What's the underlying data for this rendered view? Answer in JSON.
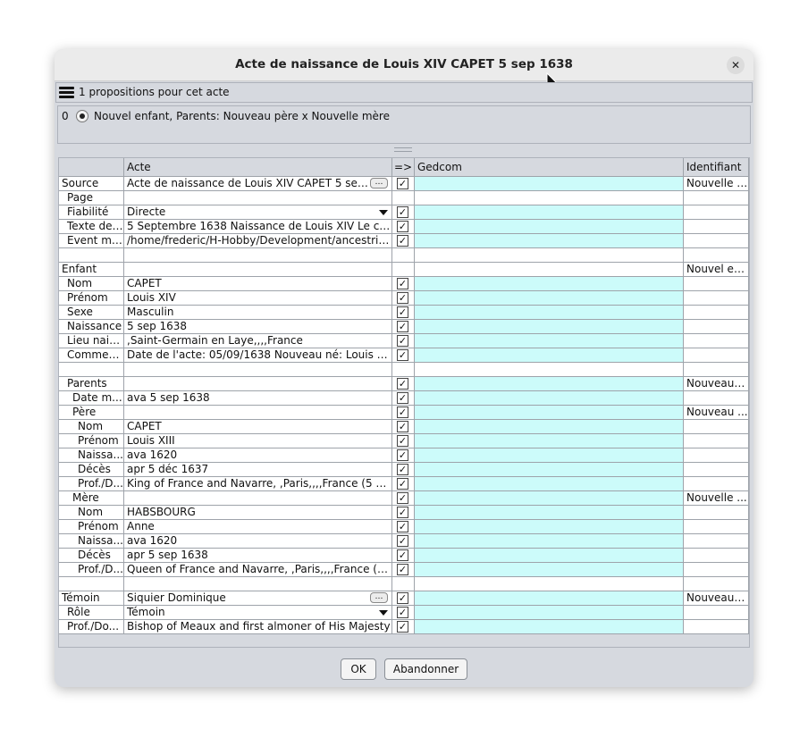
{
  "window": {
    "title": "Acte de naissance de Louis XIV CAPET 5 sep 1638",
    "close_label": "✕"
  },
  "toolbar": {
    "label": "1 propositions pour cet acte"
  },
  "proposal": {
    "index": "0",
    "label": "Nouvel enfant, Parents: Nouveau père x Nouvelle mère"
  },
  "table": {
    "columns": [
      "",
      "Acte",
      "=>",
      "Gedcom",
      "Identifiant"
    ],
    "rows": [
      {
        "label": "Source",
        "value": "Acte de naissance de Louis XIV CAPET 5 sep 16...",
        "check": true,
        "gedcom": true,
        "id": "Nouvelle s...",
        "widget": "dots"
      },
      {
        "label": "Page",
        "indent": 1,
        "value": "",
        "check": false,
        "gedcom": false,
        "id": ""
      },
      {
        "label": "Fiabilité",
        "indent": 1,
        "value": "Directe",
        "check": true,
        "gedcom": true,
        "id": "",
        "widget": "dropdown"
      },
      {
        "label": "Texte de ...",
        "indent": 1,
        "value": "5 Septembre 1638 Naissance de Louis XIV Le cinqu...",
        "check": true,
        "gedcom": true,
        "id": ""
      },
      {
        "label": "Event me...",
        "indent": 1,
        "value": "/home/frederic/H-Hobby/Development/ancestris/tr...",
        "check": true,
        "gedcom": true,
        "id": ""
      },
      {
        "label": "",
        "value": "",
        "check": false,
        "gedcom": false,
        "id": "",
        "blank": true
      },
      {
        "label": "Enfant",
        "value": "",
        "check": false,
        "gedcom": false,
        "id": "Nouvel en..."
      },
      {
        "label": "Nom",
        "indent": 1,
        "value": "CAPET",
        "check": true,
        "gedcom": true,
        "id": ""
      },
      {
        "label": "Prénom",
        "indent": 1,
        "value": "Louis XIV",
        "check": true,
        "gedcom": true,
        "id": ""
      },
      {
        "label": "Sexe",
        "indent": 1,
        "value": "Masculin",
        "check": true,
        "gedcom": true,
        "id": ""
      },
      {
        "label": "Naissance",
        "indent": 1,
        "value": "5 sep 1638",
        "check": true,
        "gedcom": true,
        "id": ""
      },
      {
        "label": "Lieu naiss.",
        "indent": 1,
        "value": ",Saint-Germain en Laye,,,,France",
        "check": true,
        "gedcom": true,
        "id": ""
      },
      {
        "label": "Commen...",
        "indent": 1,
        "value": "Date de l'acte: 05/09/1638 Nouveau né: Louis XIV C...",
        "check": true,
        "gedcom": true,
        "id": ""
      },
      {
        "label": "",
        "value": "",
        "check": false,
        "gedcom": false,
        "id": "",
        "blank": true
      },
      {
        "label": "Parents",
        "indent": 1,
        "value": "",
        "check": true,
        "gedcom": true,
        "id": "Nouveaux..."
      },
      {
        "label": "Date m...",
        "indent": 2,
        "value": "ava 5 sep 1638",
        "check": true,
        "gedcom": true,
        "id": ""
      },
      {
        "label": "Père",
        "indent": 2,
        "value": "",
        "check": true,
        "gedcom": true,
        "id": "Nouveau ..."
      },
      {
        "label": "Nom",
        "indent": 3,
        "value": "CAPET",
        "check": true,
        "gedcom": true,
        "id": ""
      },
      {
        "label": "Prénom",
        "indent": 3,
        "value": "Louis XIII",
        "check": true,
        "gedcom": true,
        "id": ""
      },
      {
        "label": "Naissa...",
        "indent": 3,
        "value": "ava 1620",
        "check": true,
        "gedcom": true,
        "id": ""
      },
      {
        "label": "Décès",
        "indent": 3,
        "value": "apr 5 déc 1637",
        "check": true,
        "gedcom": true,
        "id": ""
      },
      {
        "label": "Prof./D...",
        "indent": 3,
        "value": "King of France and Navarre, ,Paris,,,,France (5 sep ...",
        "check": true,
        "gedcom": true,
        "id": ""
      },
      {
        "label": "Mère",
        "indent": 2,
        "value": "",
        "check": true,
        "gedcom": true,
        "id": "Nouvelle ..."
      },
      {
        "label": "Nom",
        "indent": 3,
        "value": "HABSBOURG",
        "check": true,
        "gedcom": true,
        "id": ""
      },
      {
        "label": "Prénom",
        "indent": 3,
        "value": "Anne",
        "check": true,
        "gedcom": true,
        "id": ""
      },
      {
        "label": "Naissa...",
        "indent": 3,
        "value": "ava 1620",
        "check": true,
        "gedcom": true,
        "id": ""
      },
      {
        "label": "Décès",
        "indent": 3,
        "value": "apr 5 sep 1638",
        "check": true,
        "gedcom": true,
        "id": ""
      },
      {
        "label": "Prof./D...",
        "indent": 3,
        "value": "Queen of France and Navarre, ,Paris,,,,France (5 se...",
        "check": true,
        "gedcom": true,
        "id": ""
      },
      {
        "label": "",
        "value": "",
        "check": false,
        "gedcom": false,
        "id": "",
        "blank": true
      },
      {
        "label": "Témoin",
        "value": "Siquier Dominique",
        "check": true,
        "gedcom": true,
        "id": "Nouveau t...",
        "widget": "dots"
      },
      {
        "label": "Rôle",
        "indent": 1,
        "value": "Témoin",
        "check": true,
        "gedcom": true,
        "id": "",
        "widget": "dropdown"
      },
      {
        "label": "Prof./Do...",
        "indent": 1,
        "value": "Bishop of Meaux and first almoner of His Majesty",
        "check": true,
        "gedcom": true,
        "id": ""
      }
    ]
  },
  "buttons": {
    "ok": "OK",
    "cancel": "Abandonner"
  },
  "icons": {
    "menu": "hamburger-menu-icon",
    "checkbox": "checkmark-icon",
    "dots": "ellipsis-icon",
    "dropdown": "chevron-down-icon"
  },
  "colors": {
    "gedcom_cell": "#ccfbfa",
    "dialog_bg": "#d6d9df"
  }
}
